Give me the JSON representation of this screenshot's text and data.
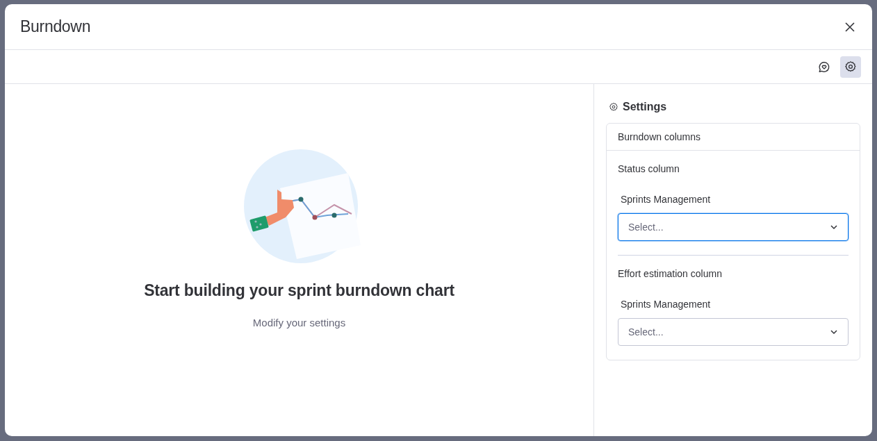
{
  "window": {
    "title": "Burndown"
  },
  "toolbar": [
    {
      "kind": "feedback",
      "selected": false
    },
    {
      "kind": "settings",
      "selected": true
    }
  ],
  "empty_state": {
    "title": "Start building your sprint burndown chart",
    "subtitle": "Modify your settings"
  },
  "settings": {
    "title": "Settings",
    "section": "Burndown columns",
    "groups": [
      {
        "label": "Status column",
        "board": "Sprints Management",
        "select": {
          "placeholder": "Select...",
          "focused": true
        }
      },
      {
        "label": "Effort estimation column",
        "board": "Sprints Management",
        "select": {
          "placeholder": "Select...",
          "focused": false
        }
      }
    ]
  }
}
